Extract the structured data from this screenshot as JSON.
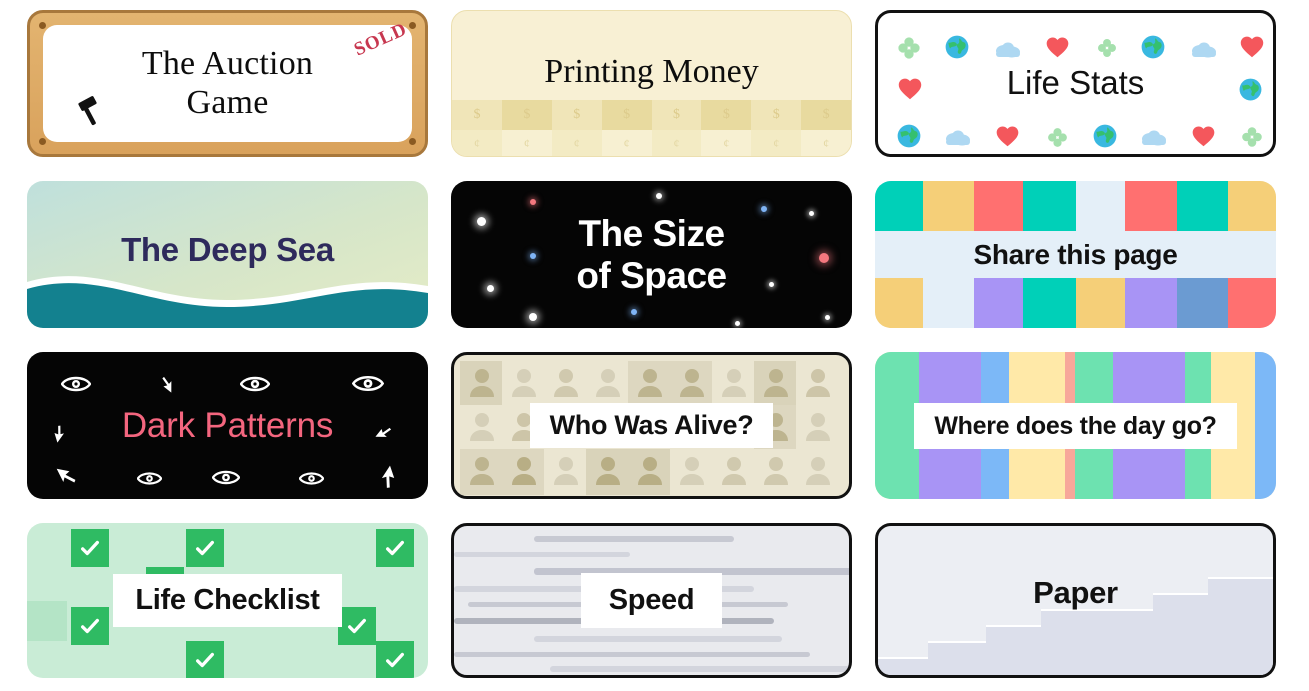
{
  "cards": [
    {
      "id": "auction-game",
      "title": "The Auction\nGame",
      "title_line1": "The Auction",
      "title_line2": "Game",
      "stamp": "SOLD",
      "icon": "gavel-icon",
      "frame_color": "#d9a25c",
      "frame_border": "#a8783c",
      "screw_color": "#8a5a22",
      "stamp_color": "#c7374f",
      "inner_bg": "#ffffff"
    },
    {
      "id": "printing-money",
      "title": "Printing Money",
      "bg": "#f8f0d4",
      "band_symbol": "$",
      "band_symbol_alt": "¢",
      "band_cells": [
        "$",
        "$",
        "$",
        "$",
        "$",
        "$",
        "$",
        "$"
      ],
      "band_cells_alt": [
        "¢",
        "¢",
        "¢",
        "¢",
        "¢",
        "¢",
        "¢",
        "¢"
      ]
    },
    {
      "id": "life-stats",
      "title": "Life Stats",
      "bg": "#ffffff",
      "border": "#111111",
      "emoji_row_top": [
        "clover-icon",
        "globe-icon",
        "cloud-icon",
        "heart-icon",
        "clover-icon",
        "globe-icon",
        "cloud-icon",
        "heart-icon"
      ],
      "emoji_row_mid": [
        "heart-icon",
        "globe-icon"
      ],
      "emoji_row_bottom": [
        "globe-icon",
        "cloud-icon",
        "heart-icon",
        "clover-icon",
        "globe-icon",
        "cloud-icon",
        "heart-icon",
        "clover-icon"
      ],
      "colors": {
        "heart": "#f4575c",
        "clover": "#a5e0ad",
        "cloud": "#aed8f2",
        "globe_land": "#35c06e",
        "globe_sea": "#39b8e0"
      }
    },
    {
      "id": "deep-sea",
      "title": "The Deep Sea",
      "text_color": "#2e2a5c",
      "wave_color": "#13818f",
      "gradient_top": "#bfe0dc",
      "gradient_bottom": "#e6ecc6"
    },
    {
      "id": "size-of-space",
      "title_line1": "The Size",
      "title_line2": "of Space",
      "bg": "#050505",
      "text_color": "#ffffff",
      "star_colors": [
        "#ffffff",
        "#7fb4f5",
        "#f4787f"
      ]
    },
    {
      "id": "share-this-page",
      "title": "Share this page",
      "bg": "#e4eff8",
      "palette": [
        "#00d0b8",
        "#f5cf78",
        "#ff7070",
        "#6b9bd2",
        "#a894f5"
      ]
    },
    {
      "id": "dark-patterns",
      "title": "Dark Patterns",
      "bg": "#050505",
      "text_color": "#f4667f",
      "icons": [
        "eye-icon",
        "cursor-icon",
        "eye-icon",
        "eye-icon",
        "cursor-icon",
        "cursor-icon",
        "cursor-icon",
        "eye-icon",
        "eye-icon",
        "eye-icon",
        "cursor-icon"
      ]
    },
    {
      "id": "who-was-alive",
      "title": "Who Was Alive?",
      "bg": "#ebe6d2",
      "border": "#111111",
      "icon": "person-icon",
      "icon_colors": [
        "#c9c2a6",
        "#b5ab87",
        "#d5cfb8"
      ]
    },
    {
      "id": "where-does-the-day-go",
      "title": "Where does the day go?",
      "stripe_colors": [
        "#6de2b0",
        "#a894f5",
        "#7cb8f7",
        "#ffe9a8",
        "#f7a79a"
      ]
    },
    {
      "id": "life-checklist",
      "title": "Life Checklist",
      "bg": "#c9ecd6",
      "check_color": "#2fbb63",
      "icon": "check-icon"
    },
    {
      "id": "speed",
      "title": "Speed",
      "bg": "#e9eaee",
      "border": "#111111",
      "line_colors": [
        "#c7c9d2",
        "#b0b3bd",
        "#d3d5dd"
      ]
    },
    {
      "id": "paper",
      "title": "Paper",
      "bg": "#eceef3",
      "border": "#111111",
      "sheet_color": "#dcdfeb"
    }
  ]
}
